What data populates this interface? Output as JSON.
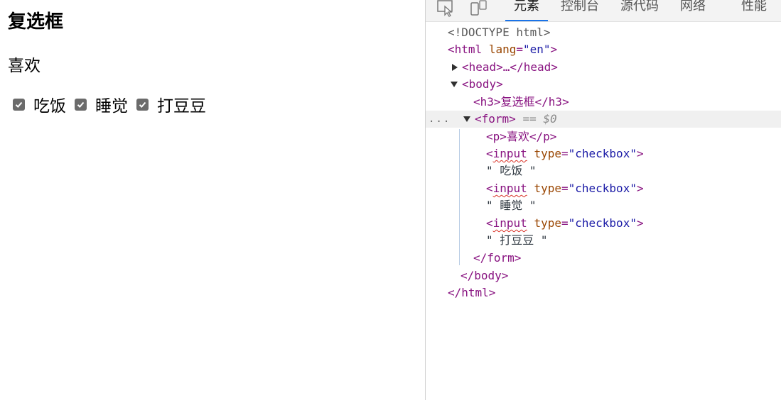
{
  "preview": {
    "heading": "复选框",
    "paragraph": "喜欢",
    "checkboxes": [
      {
        "label": "吃饭",
        "checked": true
      },
      {
        "label": "睡觉",
        "checked": true
      },
      {
        "label": "打豆豆",
        "checked": true
      }
    ]
  },
  "devtools": {
    "tabs": [
      "元素",
      "控制台",
      "源代码",
      "网络",
      "性能"
    ],
    "active_tab": "元素",
    "icons": [
      "inspect-element-icon",
      "device-toolbar-icon"
    ],
    "tree": {
      "doctype": "<!DOCTYPE html>",
      "html_open_tag": "<html",
      "html_attr_name": "lang",
      "html_attr_value": "\"en\"",
      "html_open_end": ">",
      "head_collapsed": "<head>…</head>",
      "body_open": "<body>",
      "h3_line": "<h3>复选框</h3>",
      "form_open": "<form>",
      "form_selected_marker": "== $0",
      "p_line": "<p>喜欢</p>",
      "input_open": "<",
      "input_tag": "input",
      "input_attr_name": "type",
      "input_attr_value": "\"checkbox\"",
      "input_close": ">",
      "text_1": "\" 吃饭 \"",
      "text_2": "\" 睡觉 \"",
      "text_3": "\" 打豆豆 \"",
      "form_close": "</form>",
      "body_close": "</body>",
      "html_close": "</html>",
      "ellipsis": "..."
    }
  }
}
